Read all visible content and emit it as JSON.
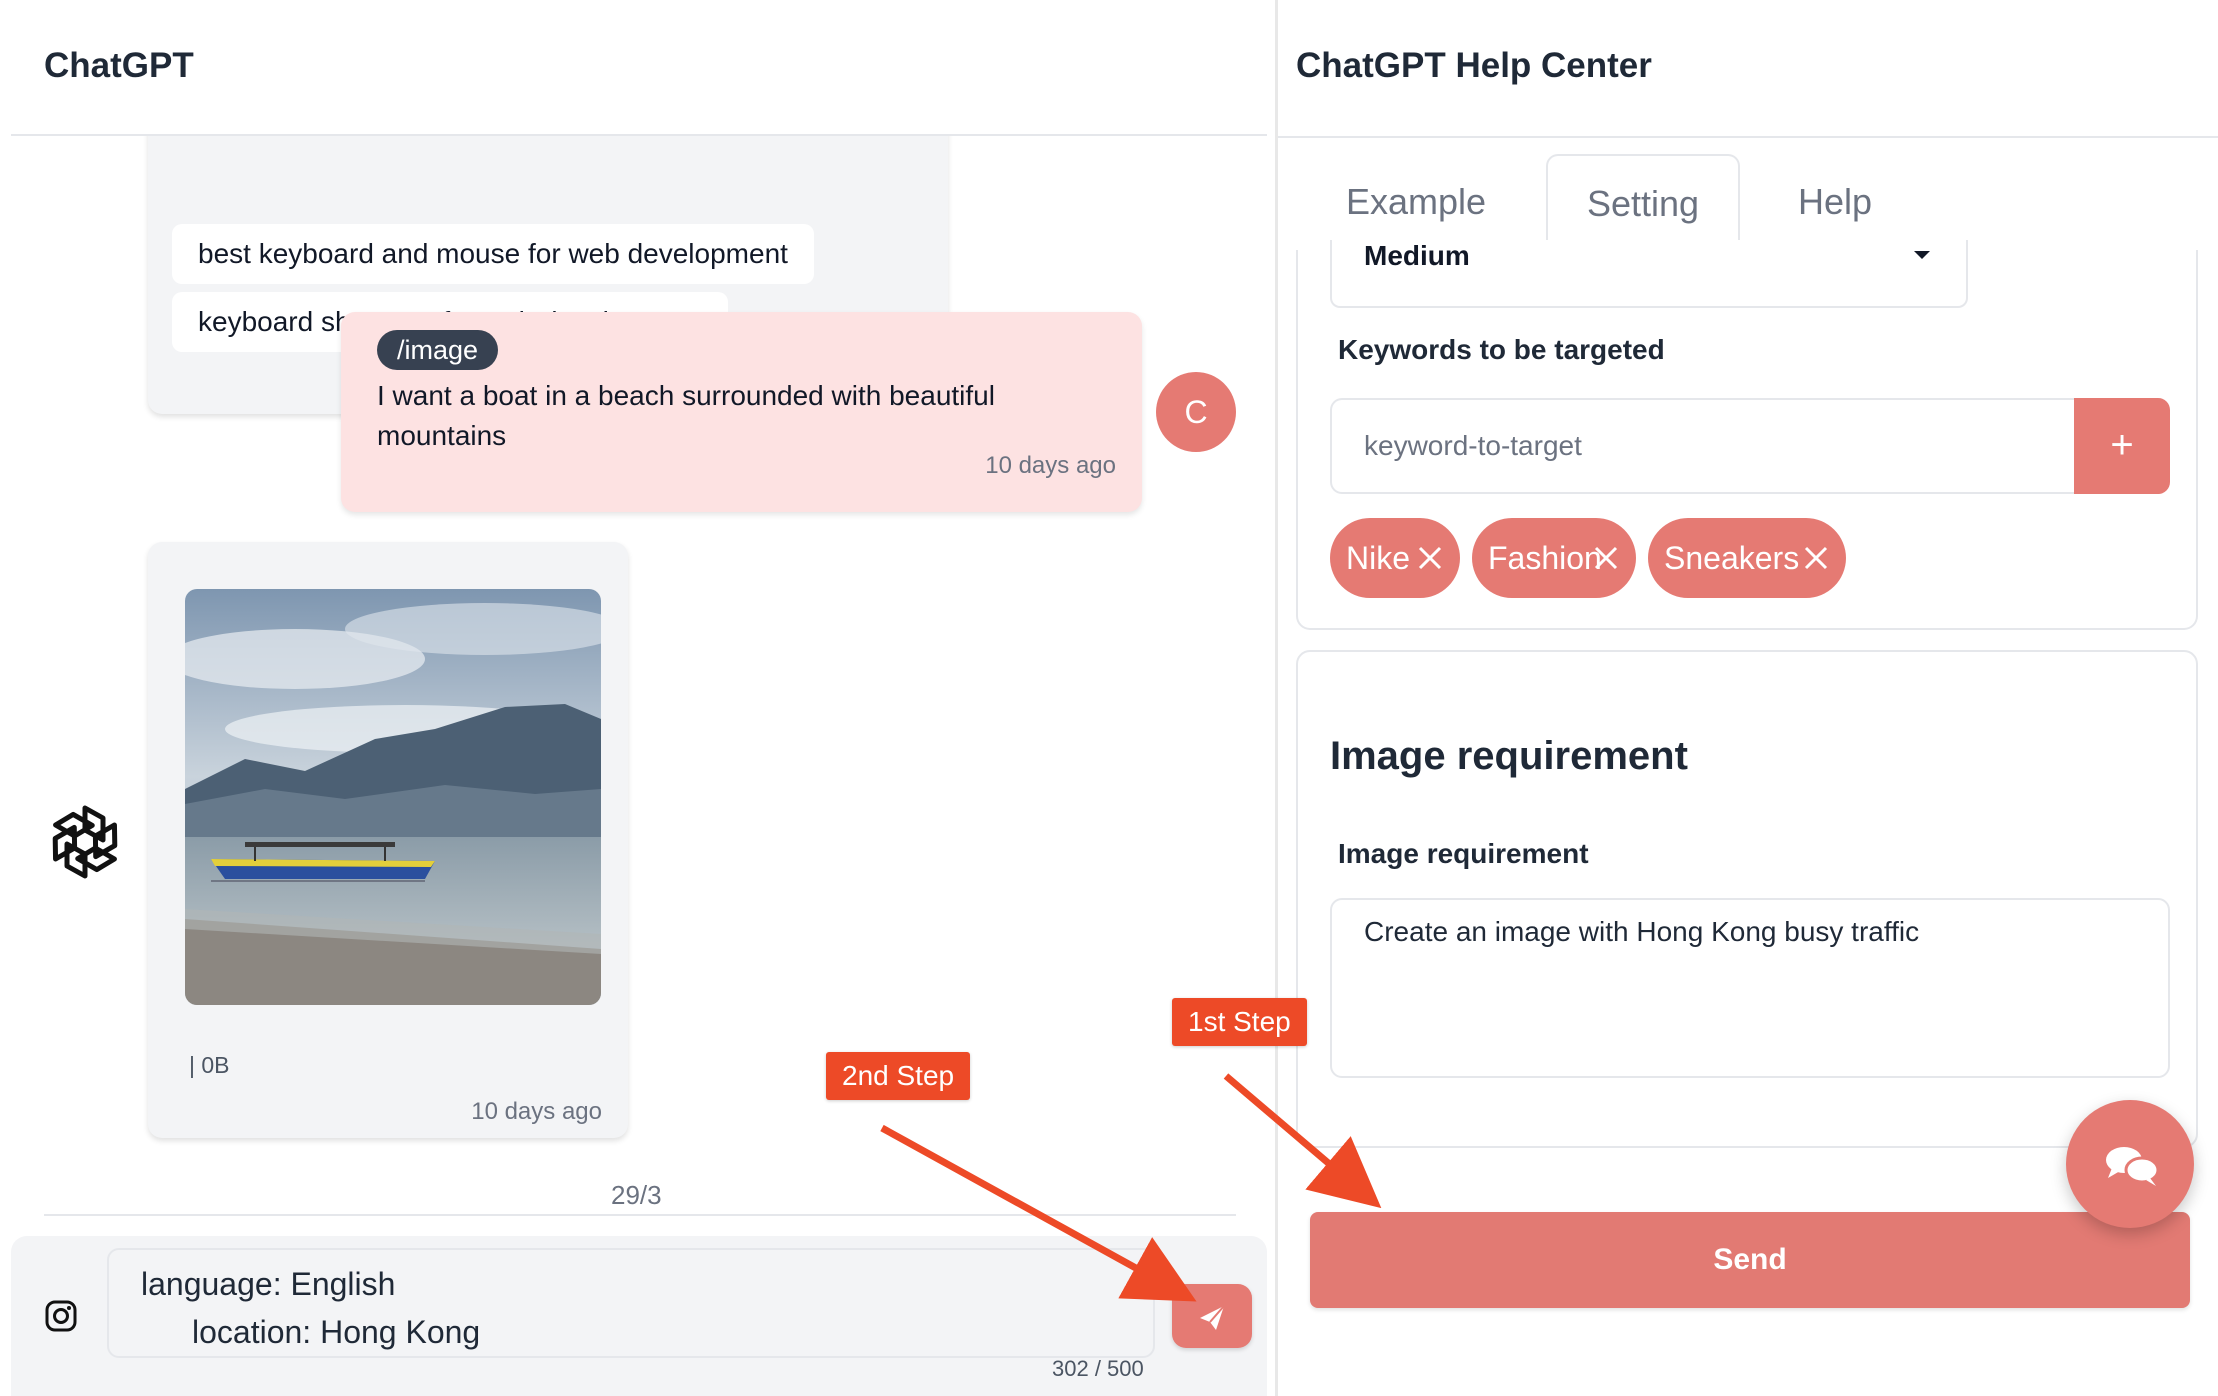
{
  "left_panel": {
    "title": "ChatGPT",
    "suggestions": [
      "best keyboard and mouse for web development",
      "keyboard shortcuts for web development"
    ],
    "user_message": {
      "command": "/image",
      "text": "I want a boat in a beach surrounded with beautiful mountains",
      "time": "10 days ago",
      "avatar_initial": "C"
    },
    "bot_image_message": {
      "meta": "| 0B",
      "time": "10 days ago"
    },
    "page_counter": "29/3",
    "composer": {
      "line1": "language: English",
      "line2": "location: Hong Kong",
      "char_count": "302 / 500"
    }
  },
  "right_panel": {
    "title": "ChatGPT Help Center",
    "tabs": [
      {
        "label": "Example",
        "active": false
      },
      {
        "label": "Setting",
        "active": true
      },
      {
        "label": "Help",
        "active": false
      }
    ],
    "settings": {
      "select_value": "Medium",
      "keywords_label": "Keywords to be targeted",
      "keyword_placeholder": "keyword-to-target",
      "add_button_label": "+",
      "keywords": [
        "Nike",
        "Fashion",
        "Sneakers"
      ]
    },
    "image_requirement": {
      "heading": "Image requirement",
      "label": "Image requirement",
      "value": "Create an image with Hong Kong busy traffic"
    },
    "send_label": "Send"
  },
  "annotations": {
    "step1": "1st Step",
    "step2": "2nd Step"
  },
  "colors": {
    "accent": "#e57a73",
    "user_bubble": "#fde2e2",
    "annotation": "#ed4a27",
    "badge_dark": "#374151"
  },
  "icons": {
    "logo": "openai-logo-icon",
    "composer_left": "instagram-icon",
    "composer_send": "paper-plane-icon",
    "floating": "chat-bubbles-icon",
    "chip_remove": "x-icon",
    "select": "caret-down-icon"
  }
}
